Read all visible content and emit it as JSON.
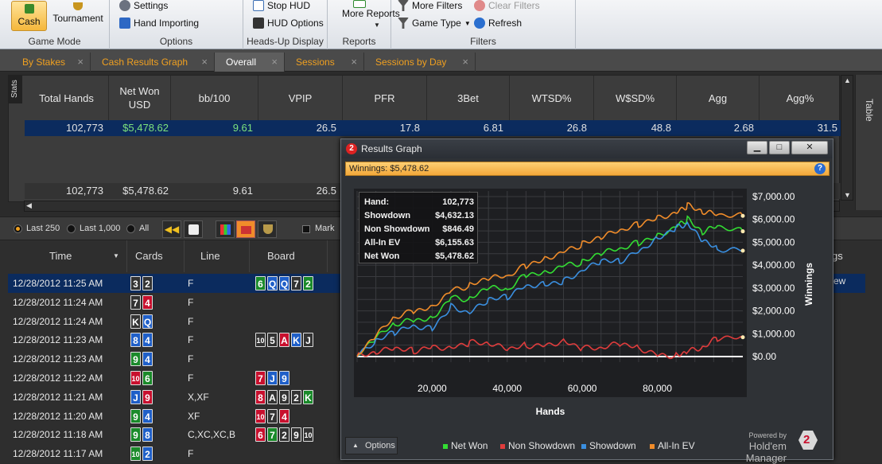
{
  "ribbon": {
    "cash_label": "Cash",
    "tournament_label": "Tournament",
    "game_mode_label": "Game Mode",
    "settings_label": "Settings",
    "hand_importing_label": "Hand Importing",
    "options_label": "Options",
    "stop_hud_label": "Stop HUD",
    "hud_options_label": "HUD Options",
    "hud_group_label": "Heads-Up Display",
    "more_reports_label": "More Reports",
    "reports_label": "Reports",
    "more_filters_label": "More Filters",
    "clear_filters_label": "Clear Filters",
    "game_type_label": "Game Type",
    "refresh_label": "Refresh",
    "filters_label": "Filters"
  },
  "tabs": [
    "By Stakes",
    "Cash Results Graph",
    "Overall",
    "Sessions",
    "Sessions by Day"
  ],
  "stats": {
    "side_label": "Stats",
    "table_side_label": "Table",
    "headers": [
      "Total Hands",
      "Net Won USD",
      "bb/100",
      "VPIP",
      "PFR",
      "3Bet",
      "WTSD%",
      "W$SD%",
      "Agg",
      "Agg%"
    ],
    "row": [
      "102,773",
      "$5,478.62",
      "9.61",
      "26.5",
      "17.8",
      "6.81",
      "26.8",
      "48.8",
      "2.68",
      "31.5"
    ],
    "total_row": [
      "102,773",
      "$5,478.62",
      "9.61",
      "26.5"
    ]
  },
  "filterbar": {
    "last250": "Last 250",
    "last1000": "Last 1,000",
    "all": "All",
    "mark": "Mark"
  },
  "hands": {
    "headers": [
      "Time",
      "Cards",
      "Line",
      "Board"
    ],
    "right_fragment_header": "gs",
    "right_fragment_cell": "ew",
    "rows": [
      {
        "time": "12/28/2012 11:25 AM",
        "line": "F"
      },
      {
        "time": "12/28/2012 11:24 AM",
        "line": "F"
      },
      {
        "time": "12/28/2012 11:24 AM",
        "line": "F"
      },
      {
        "time": "12/28/2012 11:23 AM",
        "line": "F"
      },
      {
        "time": "12/28/2012 11:23 AM",
        "line": "F"
      },
      {
        "time": "12/28/2012 11:22 AM",
        "line": "F"
      },
      {
        "time": "12/28/2012 11:21 AM",
        "line": "X,XF"
      },
      {
        "time": "12/28/2012 11:20 AM",
        "line": "XF"
      },
      {
        "time": "12/28/2012 11:18 AM",
        "line": "C,XC,XC,B"
      },
      {
        "time": "12/28/2012 11:17 AM",
        "line": "F"
      }
    ]
  },
  "graph_window": {
    "title": "Results Graph",
    "winnings_label": "Winnings: $5,478.62",
    "options_label": "Options",
    "powered_by": "Powered by",
    "brand": "Hold'em Manager",
    "info": [
      {
        "k": "Hand:",
        "v": "102,773"
      },
      {
        "k": "Showdown",
        "v": "$4,632.13"
      },
      {
        "k": "Non Showdown",
        "v": "$846.49"
      },
      {
        "k": "All-In EV",
        "v": "$6,155.63"
      },
      {
        "k": "Net Won",
        "v": "$5,478.62"
      }
    ]
  },
  "chart_data": {
    "type": "line",
    "xlabel": "Hands",
    "ylabel": "Winnings",
    "xlim": [
      0,
      102773
    ],
    "ylim": [
      0,
      7000
    ],
    "x_ticks": [
      "20,000",
      "40,000",
      "60,000",
      "80,000"
    ],
    "y_ticks": [
      "$7,000.00",
      "$6,000.00",
      "$5,000.00",
      "$4,000.00",
      "$3,000.00",
      "$2,000.00",
      "$1,000.00",
      "$0.00"
    ],
    "grid": true,
    "legend": "bottom",
    "x": [
      0,
      5000,
      10000,
      15000,
      20000,
      25000,
      30000,
      35000,
      40000,
      45000,
      50000,
      55000,
      60000,
      65000,
      70000,
      75000,
      80000,
      85000,
      88000,
      92000,
      96000,
      102773
    ],
    "series": [
      {
        "name": "Net Won",
        "color": "#33dd33",
        "values": [
          0,
          800,
          1400,
          1600,
          1700,
          2600,
          2500,
          3000,
          2900,
          3600,
          3700,
          4000,
          4100,
          4500,
          4700,
          5000,
          5300,
          5700,
          6000,
          5400,
          5700,
          5479
        ]
      },
      {
        "name": "Non Showdown",
        "color": "#e03c3c",
        "values": [
          0,
          150,
          350,
          250,
          450,
          400,
          600,
          550,
          300,
          500,
          500,
          700,
          350,
          350,
          550,
          400,
          100,
          50,
          200,
          350,
          800,
          846
        ]
      },
      {
        "name": "Showdown",
        "color": "#3a8fe0",
        "values": [
          0,
          650,
          1050,
          1350,
          1250,
          2200,
          1900,
          2450,
          2600,
          3100,
          3200,
          3300,
          3750,
          4150,
          4150,
          4600,
          5200,
          5650,
          5800,
          5050,
          4700,
          4632
        ]
      },
      {
        "name": "All-In EV",
        "color": "#f08c2a",
        "values": [
          0,
          900,
          1700,
          2000,
          2200,
          2900,
          3100,
          3400,
          3500,
          4000,
          4300,
          4600,
          4900,
          5200,
          5500,
          5800,
          6100,
          6300,
          6600,
          6300,
          6200,
          6156
        ]
      }
    ]
  }
}
